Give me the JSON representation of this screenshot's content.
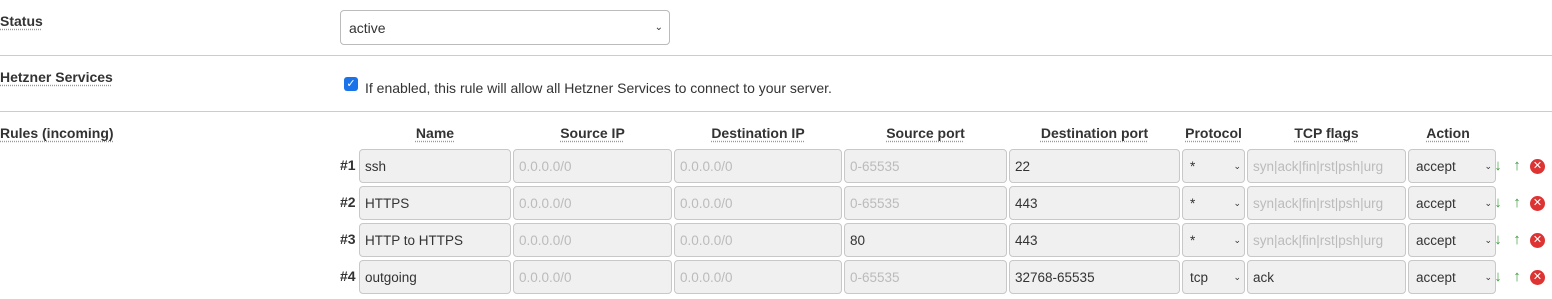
{
  "status": {
    "label": "Status",
    "value": "active"
  },
  "hetzner": {
    "label": "Hetzner Services",
    "checked": true,
    "text": "If enabled, this rule will allow all Hetzner Services to connect to your server."
  },
  "rules": {
    "label": "Rules (incoming)",
    "columns": [
      "Name",
      "Source IP",
      "Destination IP",
      "Source port",
      "Destination port",
      "Protocol",
      "TCP flags",
      "Action"
    ],
    "placeholders": {
      "source_ip": "0.0.0.0/0",
      "destination_ip": "0.0.0.0/0",
      "source_port": "0-65535",
      "tcp_flags": "syn|ack|fin|rst|psh|urg"
    },
    "rows": [
      {
        "num": "#1",
        "name": "ssh",
        "source_ip": "",
        "destination_ip": "",
        "source_port": "",
        "destination_port": "22",
        "protocol": "*",
        "tcp_flags": "",
        "action": "accept"
      },
      {
        "num": "#2",
        "name": "HTTPS",
        "source_ip": "",
        "destination_ip": "",
        "source_port": "",
        "destination_port": "443",
        "protocol": "*",
        "tcp_flags": "",
        "action": "accept"
      },
      {
        "num": "#3",
        "name": "HTTP to HTTPS",
        "source_ip": "",
        "destination_ip": "",
        "source_port": "80",
        "destination_port": "443",
        "protocol": "*",
        "tcp_flags": "",
        "action": "accept"
      },
      {
        "num": "#4",
        "name": "outgoing",
        "source_ip": "",
        "destination_ip": "",
        "source_port": "",
        "destination_port": "32768-65535",
        "protocol": "tcp",
        "tcp_flags": "ack",
        "action": "accept"
      }
    ]
  },
  "icons": {
    "move_down": "arrow-down-icon",
    "move_up": "arrow-up-icon",
    "delete": "delete-icon"
  },
  "colors": {
    "checkbox": "#1a73e8",
    "arrows": "#3a9a3a",
    "delete": "#dd3333"
  }
}
